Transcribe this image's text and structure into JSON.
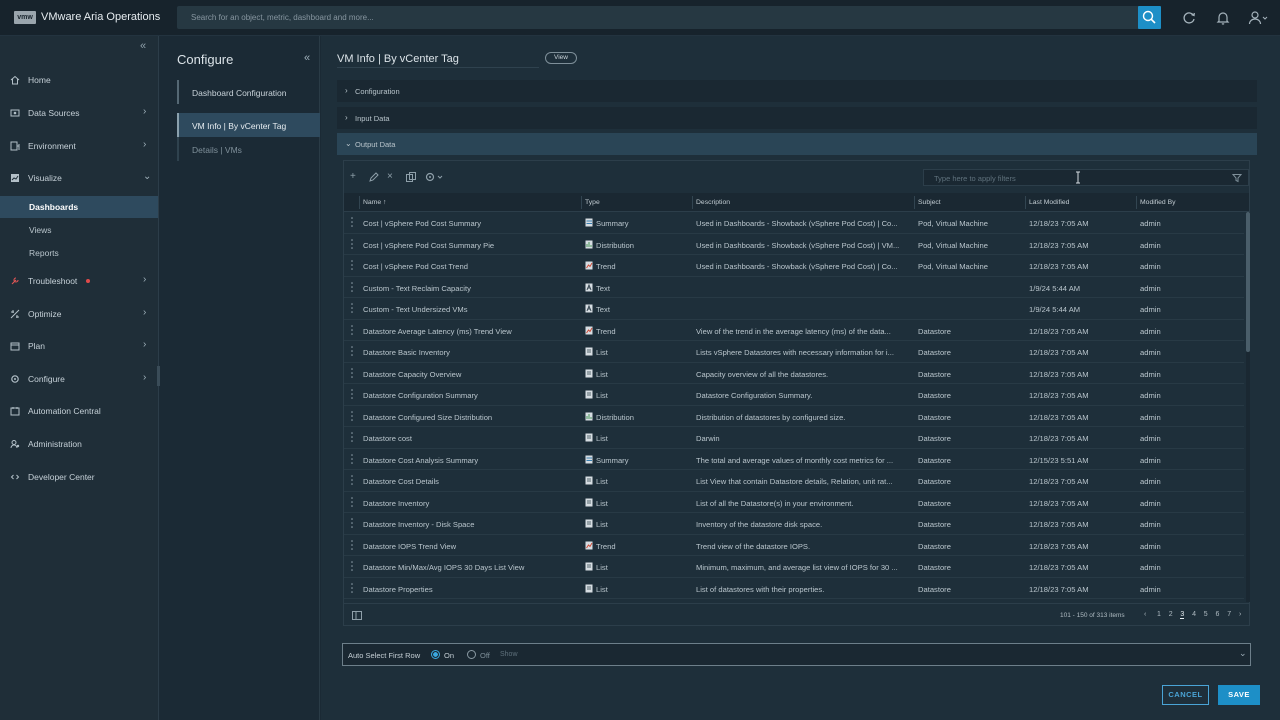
{
  "app": {
    "logo": "vmw",
    "title": "VMware Aria Operations"
  },
  "search": {
    "placeholder": "Search for an object, metric, dashboard and more..."
  },
  "topbar_icons": [
    "search-icon",
    "refresh-icon",
    "bell-icon",
    "user-icon"
  ],
  "sidebar": {
    "items": [
      {
        "label": "Home",
        "icon": "home-icon",
        "chevron": ""
      },
      {
        "label": "Data Sources",
        "icon": "data-sources-icon",
        "chevron": "›"
      },
      {
        "label": "Environment",
        "icon": "environment-icon",
        "chevron": "›"
      },
      {
        "label": "Visualize",
        "icon": "visualize-icon",
        "chevron": "⌄"
      },
      {
        "label": "Troubleshoot",
        "icon": "troubleshoot-icon",
        "chevron": "›"
      },
      {
        "label": "Optimize",
        "icon": "optimize-icon",
        "chevron": "›"
      },
      {
        "label": "Plan",
        "icon": "plan-icon",
        "chevron": "›"
      },
      {
        "label": "Configure",
        "icon": "configure-icon",
        "chevron": "›"
      },
      {
        "label": "Automation Central",
        "icon": "automation-icon",
        "chevron": ""
      },
      {
        "label": "Administration",
        "icon": "administration-icon",
        "chevron": ""
      },
      {
        "label": "Developer Center",
        "icon": "developer-icon",
        "chevron": ""
      }
    ],
    "visualize_sub": [
      "Dashboards",
      "Views",
      "Reports"
    ],
    "active_sub": "Dashboards"
  },
  "configure_panel": {
    "title": "Configure",
    "items": [
      "Dashboard Configuration",
      "VM Info | By vCenter Tag",
      "Details | VMs"
    ]
  },
  "main": {
    "title": "VM Info | By vCenter Tag",
    "view_pill": "View",
    "sections": [
      "Configuration",
      "Input Data",
      "Output Data"
    ]
  },
  "grid": {
    "filter_placeholder": "Type here to apply filters",
    "columns": [
      "Name",
      "Type",
      "Description",
      "Subject",
      "Last Modified",
      "Modified By"
    ],
    "sort_indicator": "↑",
    "rows": [
      [
        "Cost | vSphere Pod Cost Summary",
        "Summary",
        "Used in Dashboards - Showback (vSphere Pod Cost) | Co...",
        "Pod, Virtual Machine",
        "12/18/23 7:05 AM",
        "admin"
      ],
      [
        "Cost | vSphere Pod Cost Summary Pie",
        "Distribution",
        "Used in Dashboards - Showback (vSphere Pod Cost) | VM...",
        "Pod, Virtual Machine",
        "12/18/23 7:05 AM",
        "admin"
      ],
      [
        "Cost | vSphere Pod Cost Trend",
        "Trend",
        "Used in Dashboards - Showback (vSphere Pod Cost) | Co...",
        "Pod, Virtual Machine",
        "12/18/23 7:05 AM",
        "admin"
      ],
      [
        "Custom - Text Reclaim Capacity",
        "Text",
        "",
        "",
        "1/9/24 5:44 AM",
        "admin"
      ],
      [
        "Custom - Text Undersized VMs",
        "Text",
        "",
        "",
        "1/9/24 5:44 AM",
        "admin"
      ],
      [
        "Datastore Average Latency (ms) Trend View",
        "Trend",
        "View of the trend in the average latency (ms) of the data...",
        "Datastore",
        "12/18/23 7:05 AM",
        "admin"
      ],
      [
        "Datastore Basic Inventory",
        "List",
        "Lists vSphere Datastores with necessary information for i...",
        "Datastore",
        "12/18/23 7:05 AM",
        "admin"
      ],
      [
        "Datastore Capacity Overview",
        "List",
        "Capacity overview of all the datastores.",
        "Datastore",
        "12/18/23 7:05 AM",
        "admin"
      ],
      [
        "Datastore Configuration Summary",
        "List",
        "Datastore Configuration Summary.",
        "Datastore",
        "12/18/23 7:05 AM",
        "admin"
      ],
      [
        "Datastore Configured Size Distribution",
        "Distribution",
        "Distribution of datastores by configured size.",
        "Datastore",
        "12/18/23 7:05 AM",
        "admin"
      ],
      [
        "Datastore cost",
        "List",
        "Darwin",
        "Datastore",
        "12/18/23 7:05 AM",
        "admin"
      ],
      [
        "Datastore Cost Analysis Summary",
        "Summary",
        "The total and average values of monthly cost metrics for ...",
        "Datastore",
        "12/15/23 5:51 AM",
        "admin"
      ],
      [
        "Datastore Cost Details",
        "List",
        "List View that contain Datastore details, Relation, unit rat...",
        "Datastore",
        "12/18/23 7:05 AM",
        "admin"
      ],
      [
        "Datastore Inventory",
        "List",
        "List of all the Datastore(s) in your environment.",
        "Datastore",
        "12/18/23 7:05 AM",
        "admin"
      ],
      [
        "Datastore Inventory - Disk Space",
        "List",
        "Inventory of the datastore disk space.",
        "Datastore",
        "12/18/23 7:05 AM",
        "admin"
      ],
      [
        "Datastore IOPS Trend View",
        "Trend",
        "Trend view of the datastore IOPS.",
        "Datastore",
        "12/18/23 7:05 AM",
        "admin"
      ],
      [
        "Datastore Min/Max/Avg IOPS 30 Days List View",
        "List",
        "Minimum, maximum, and average list view of IOPS for 30 ...",
        "Datastore",
        "12/18/23 7:05 AM",
        "admin"
      ],
      [
        "Datastore Properties",
        "List",
        "List of datastores with their properties.",
        "Datastore",
        "12/18/23 7:05 AM",
        "admin"
      ]
    ],
    "pagination": {
      "info": "101 - 150 of 313 items",
      "pages": [
        "1",
        "2",
        "3",
        "4",
        "5",
        "6",
        "7"
      ],
      "current": "3",
      "prev": "‹",
      "next": "›"
    }
  },
  "auto_select": {
    "label": "Auto Select First Row",
    "on_label": "On",
    "off_label": "Off",
    "show_label": "Show",
    "selected": "On"
  },
  "actions": {
    "cancel": "CANCEL",
    "save": "SAVE"
  },
  "colors": {
    "accent": "#1d8fc7",
    "nav_active": "#2e4a5e",
    "section_open": "#2a4556",
    "alert_dot": "#e04a4a"
  }
}
